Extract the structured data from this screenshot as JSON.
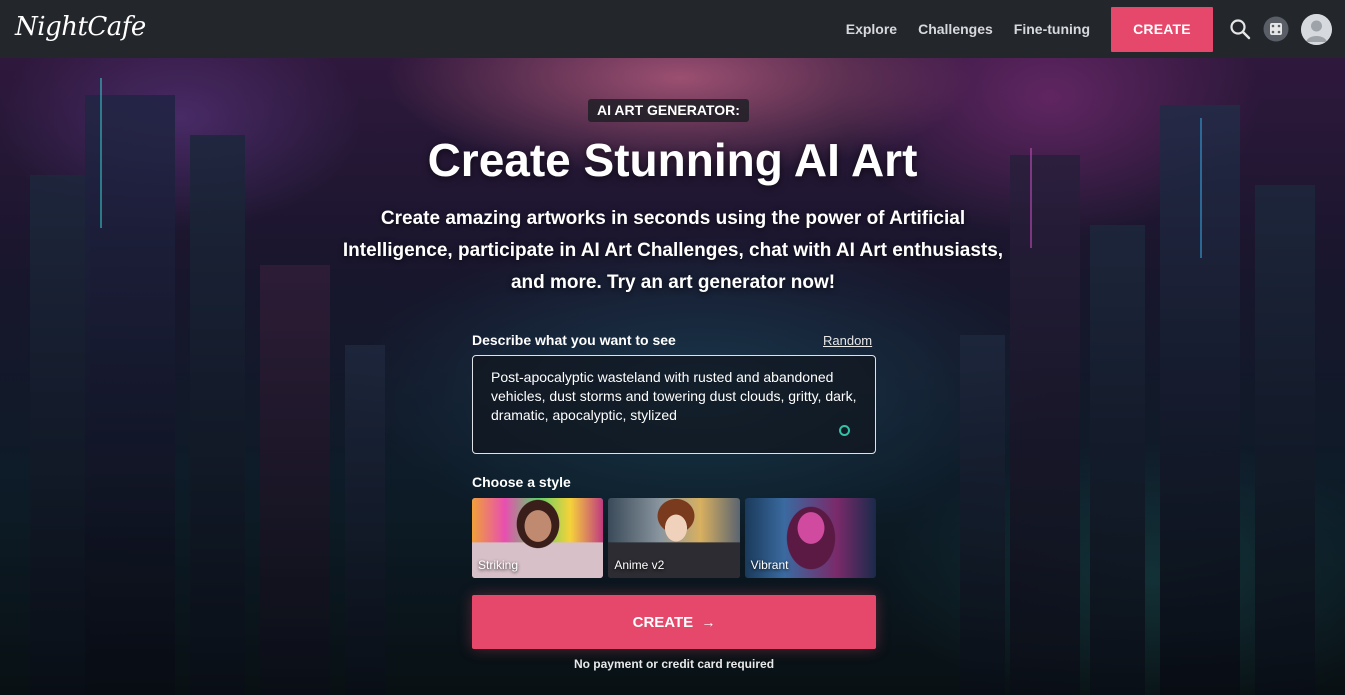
{
  "header": {
    "logo_text": "NightCafe",
    "nav": [
      "Explore",
      "Challenges",
      "Fine-tuning"
    ],
    "create_label": "CREATE",
    "icons": [
      "search-icon",
      "dice-icon",
      "avatar-icon"
    ]
  },
  "hero": {
    "badge": "AI ART GENERATOR:",
    "title": "Create Stunning AI Art",
    "subtitle": "Create amazing artworks in seconds using the power of Artificial Intelligence, participate in AI Art Challenges, chat with AI Art enthusiasts, and more. Try an art generator now!"
  },
  "form": {
    "describe_label": "Describe what you want to see",
    "random_label": "Random",
    "prompt_value": "Post-apocalyptic wasteland with rusted and abandoned vehicles, dust storms and towering dust clouds, gritty, dark, dramatic, apocalyptic, stylized",
    "style_label": "Choose a style",
    "styles": [
      {
        "label": "Striking",
        "selected": true
      },
      {
        "label": "Anime v2",
        "selected": false
      },
      {
        "label": "Vibrant",
        "selected": false
      }
    ],
    "create_label": "CREATE",
    "create_icon": "arrow-right-icon",
    "note": "No payment or credit card required"
  },
  "colors": {
    "accent": "#e5486a",
    "nav_bg": "#23262b",
    "selected_outline": "#3b8fe0",
    "resize_dot": "#2fc4a8"
  }
}
